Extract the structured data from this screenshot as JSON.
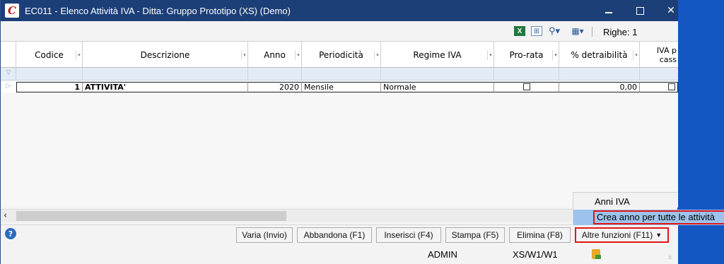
{
  "window": {
    "title": "EC011 - Elenco Attività IVA - Ditta: Gruppo Prototipo (XS) (Demo)",
    "app_icon_glyph": "C"
  },
  "toolbar": {
    "righe_label": "Righe: 1",
    "excel_glyph": "X"
  },
  "columns": [
    {
      "label": "Codice"
    },
    {
      "label": "Descrizione"
    },
    {
      "label": "Anno"
    },
    {
      "label": "Periodicità"
    },
    {
      "label": "Regime IVA"
    },
    {
      "label": "Pro-rata"
    },
    {
      "label": "% detraibilità"
    },
    {
      "label": "IVA p\ncass"
    }
  ],
  "rows": [
    {
      "codice": "1",
      "descrizione": "ATTIVITA'",
      "anno": "2020",
      "periodicita": "Mensile",
      "regime_iva": "Normale",
      "pro_rata": false,
      "detraibilita": "0,00",
      "iva_cassa": false
    }
  ],
  "menu": {
    "items": [
      {
        "label": "Anni IVA"
      },
      {
        "label": "Crea anno per tutte le attività"
      }
    ]
  },
  "buttons": {
    "varia": "Varia (Invio)",
    "abbandona": "Abbandona (F1)",
    "inserisci": "Inserisci (F4)",
    "stampa": "Stampa (F5)",
    "elimina": "Elimina (F8)",
    "altre": "Altre funzioni (F11)"
  },
  "status": {
    "user": "ADMIN",
    "path": "XS/W1/W1"
  },
  "colors": {
    "titlebar": "#1d3f78",
    "desktop": "#1456c2",
    "highlight_red": "#e0151b",
    "menu_selected": "#9dc3ec"
  }
}
